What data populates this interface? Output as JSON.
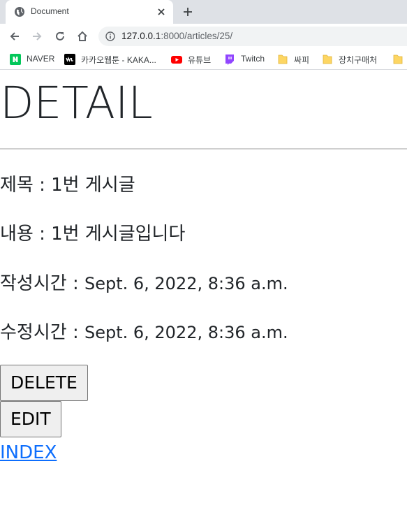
{
  "browser": {
    "tab": {
      "title": "Document"
    },
    "address": {
      "host": "127.0.0.1",
      "path": ":8000/articles/25/"
    },
    "bookmarks": [
      {
        "label": "NAVER",
        "icon": "naver-icon"
      },
      {
        "label": "카카오웹툰 - KAKA...",
        "icon": "kakao-webtoon-icon"
      },
      {
        "label": "유튜브",
        "icon": "youtube-icon"
      },
      {
        "label": "Twitch",
        "icon": "twitch-icon"
      },
      {
        "label": "싸피",
        "icon": "folder-icon"
      },
      {
        "label": "장치구매처",
        "icon": "folder-icon"
      }
    ]
  },
  "page": {
    "title": "DETAIL",
    "fields": {
      "title": {
        "label": "제목 : ",
        "value": "1번 게시글"
      },
      "content": {
        "label": "내용 : ",
        "value": "1번 게시글입니다"
      },
      "created": {
        "label": "작성시간 : ",
        "value": "Sept. 6, 2022, 8:36 a.m."
      },
      "updated": {
        "label": "수정시간 : ",
        "value": "Sept. 6, 2022, 8:36 a.m."
      }
    },
    "buttons": {
      "delete": "DELETE",
      "edit": "EDIT"
    },
    "index_link": "INDEX"
  },
  "colors": {
    "link": "#0d6efd",
    "text": "#212529",
    "tabstrip": "#dee1e6"
  }
}
